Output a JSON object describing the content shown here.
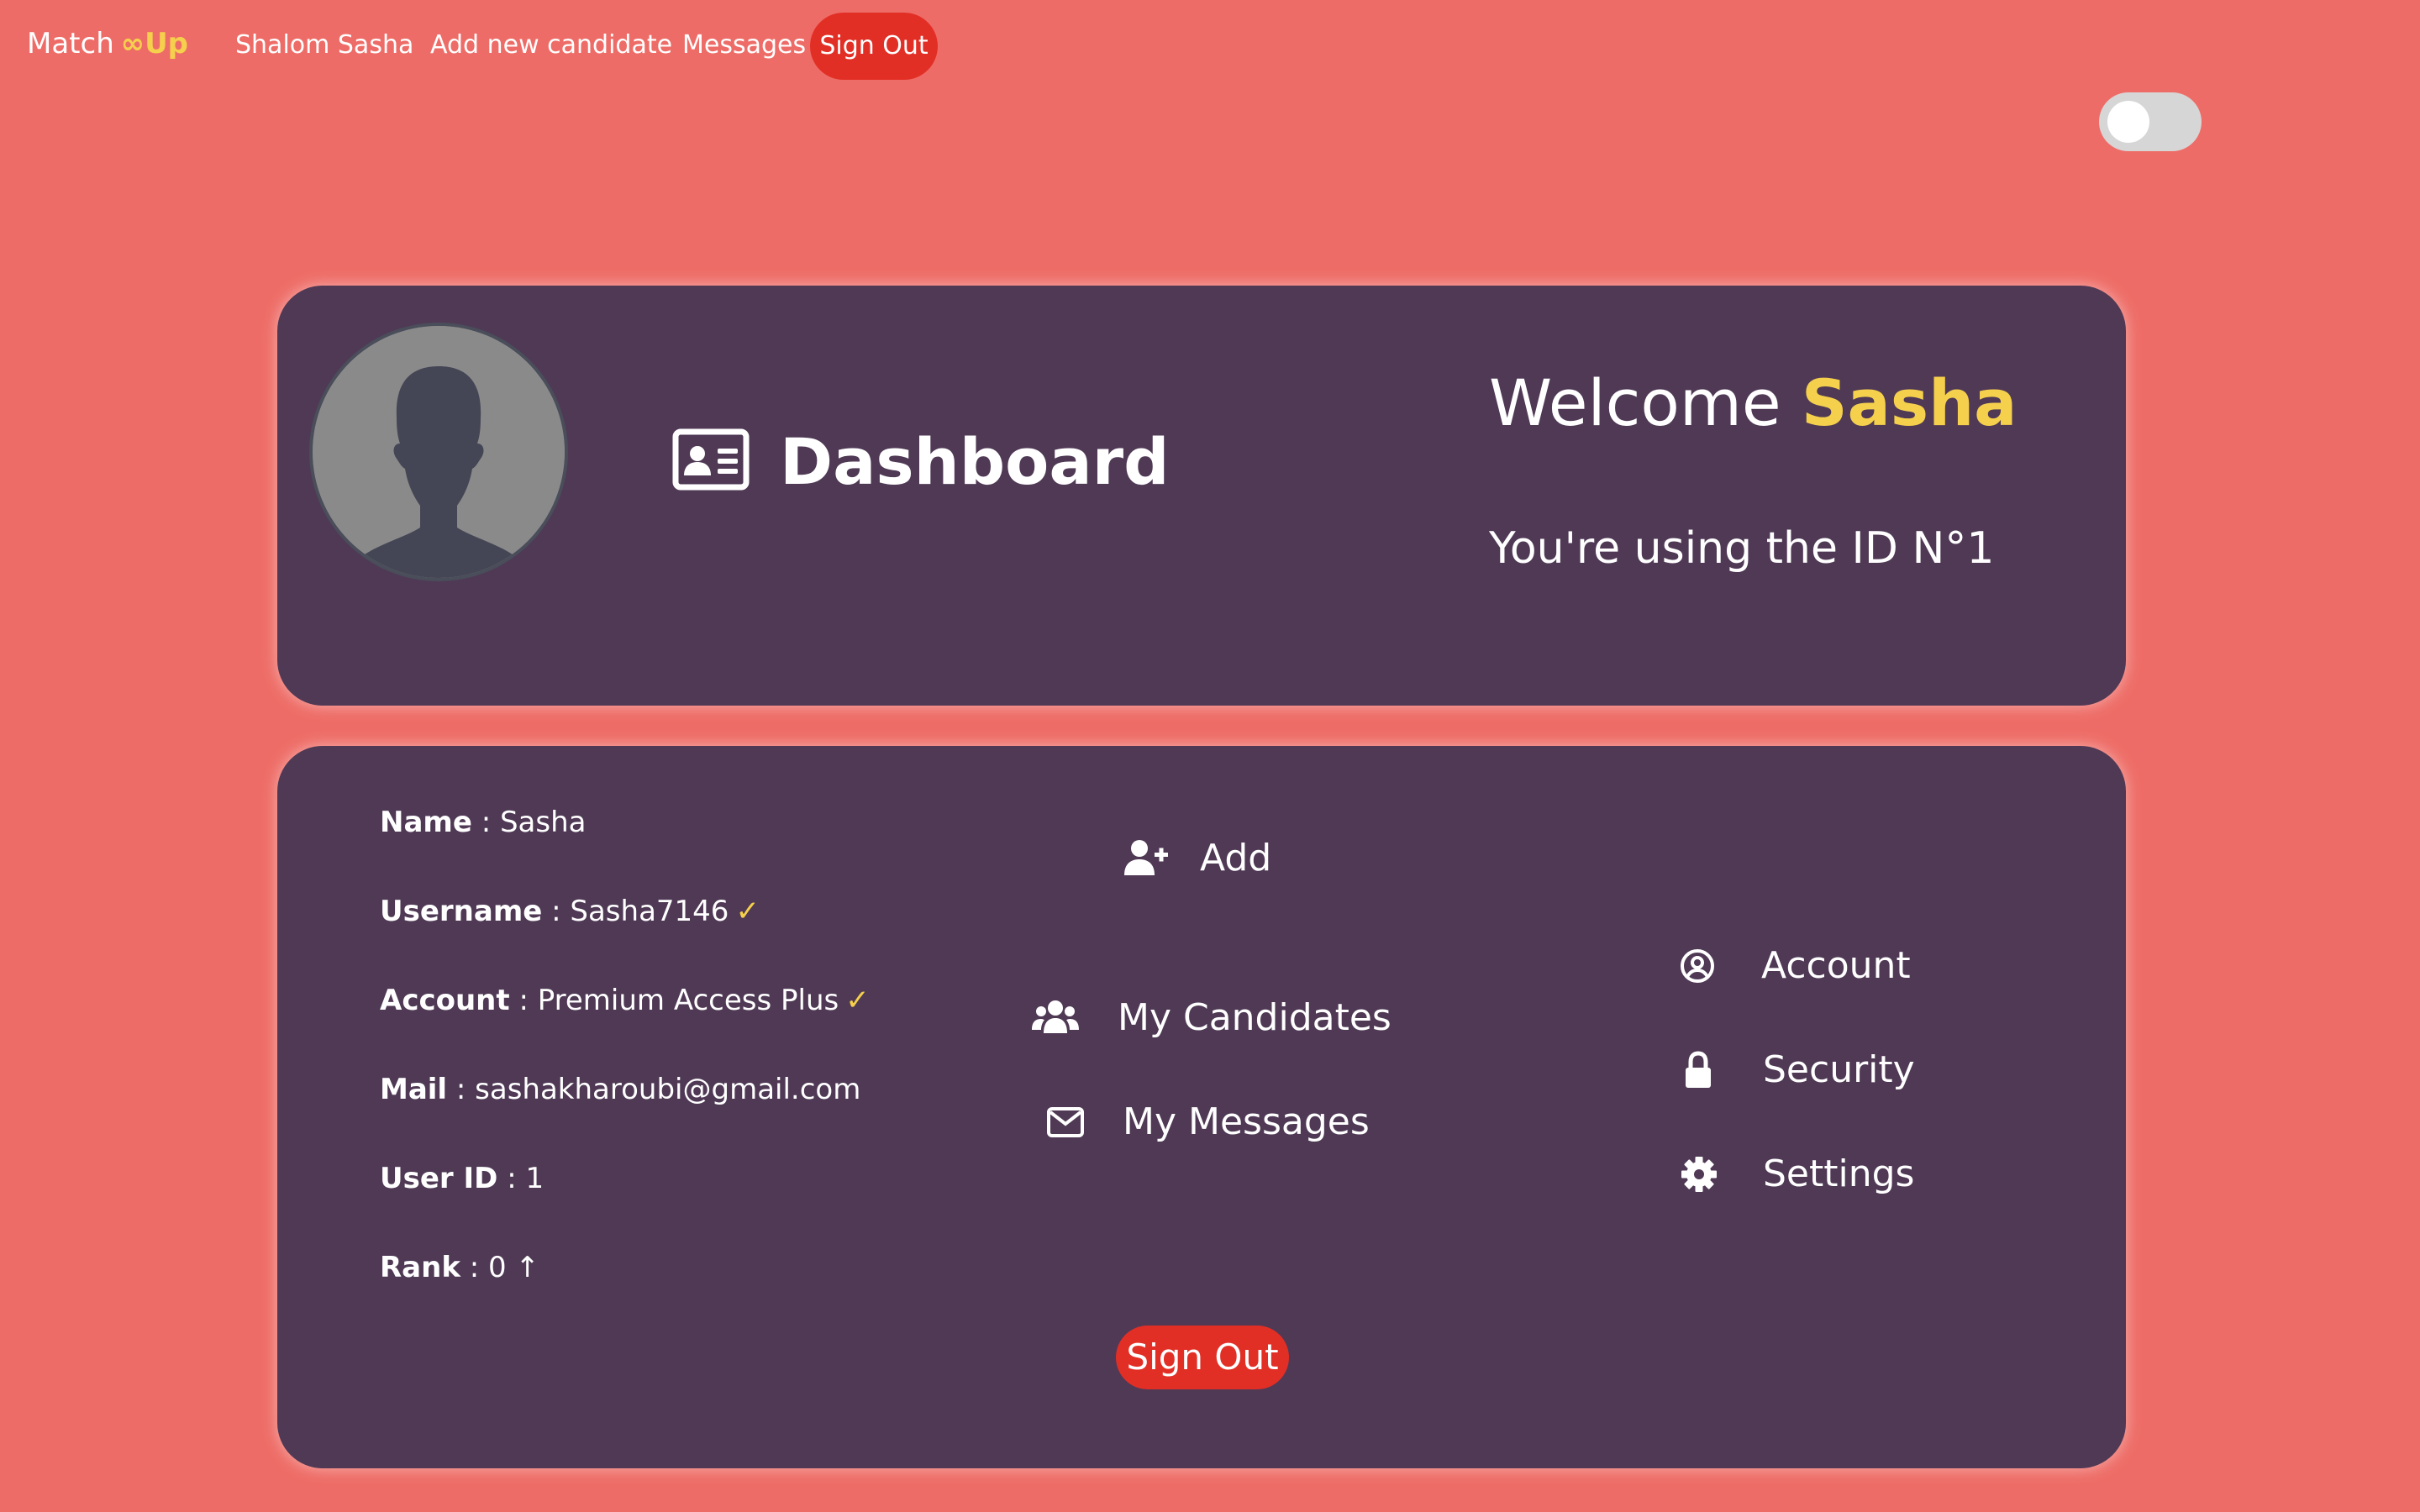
{
  "nav": {
    "brand_text": "Match",
    "brand_mark": "∞Up",
    "greeting": "Shalom Sasha",
    "add_candidate": "Add new candidate",
    "messages": "Messages",
    "sign_out": "Sign Out"
  },
  "theme_toggle": {
    "state": "off"
  },
  "header": {
    "title": "Dashboard",
    "welcome_prefix": "Welcome",
    "welcome_name": "Sasha",
    "id_text": "You're using the ID N°1"
  },
  "profile": {
    "name_label": "Name",
    "name_value": " : Sasha",
    "username_label": "Username",
    "username_value": " : Sasha7146",
    "account_label": "Account",
    "account_value": " : Premium Access Plus",
    "mail_label": "Mail",
    "mail_value": " : sashakharoubi@gmail.com",
    "userid_label": "User ID",
    "userid_value": " : 1",
    "rank_label": "Rank",
    "rank_value": " : 0 ↑",
    "check_mark": "✓"
  },
  "actions": {
    "add": "Add",
    "my_candidates": "My Candidates",
    "my_messages": "My Messages",
    "account": "Account",
    "security": "Security",
    "settings": "Settings"
  },
  "footer": {
    "sign_out": "Sign Out"
  },
  "colors": {
    "background": "#ee6c67",
    "card": "#4f3955",
    "accent_yellow": "#f5d04c",
    "sign_out_red": "#e22f26"
  },
  "icons": {
    "dashboard": "id-card-icon",
    "add": "user-plus-icon",
    "candidates": "users-icon",
    "messages": "envelope-icon",
    "account": "user-circle-icon",
    "security": "lock-icon",
    "settings": "gear-icon"
  }
}
